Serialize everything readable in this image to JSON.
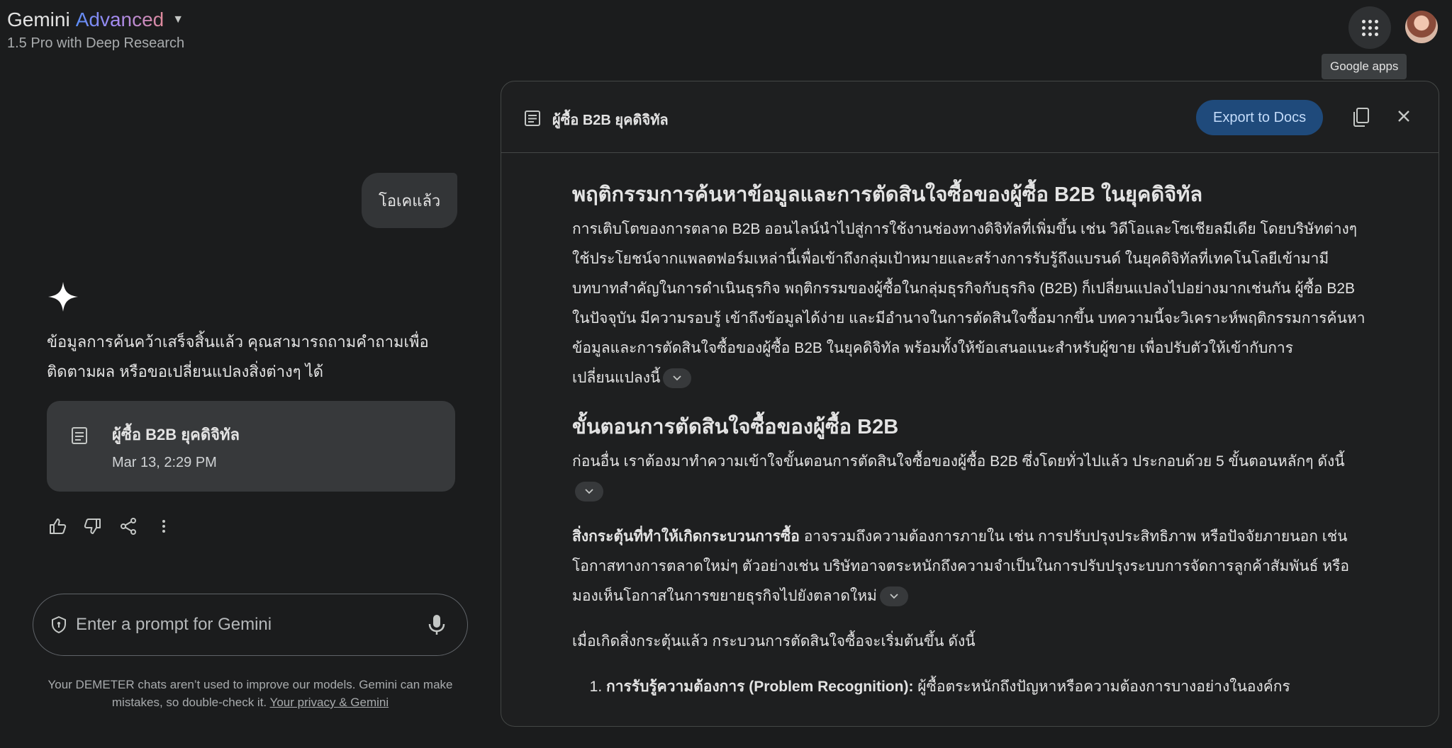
{
  "header": {
    "brand_name": "Gemini",
    "brand_tier": "Advanced",
    "model_subtitle": "1.5 Pro with Deep Research",
    "apps_tooltip": "Google apps",
    "icons": {
      "apps": "apps-grid-icon",
      "avatar": "user-avatar",
      "caret": "caret-down-icon"
    }
  },
  "chat": {
    "user_message": "โอเคแล้ว",
    "answer_text": "ข้อมูลการค้นคว้าเสร็จสิ้นแล้ว คุณสามารถถามคำถามเพื่อติดตามผล หรือขอเปลี่ยนแปลงสิ่งต่างๆ ได้",
    "doc_card": {
      "title": "ผู้ซื้อ B2B ยุคดิจิทัล",
      "date": "Mar 13, 2:29 PM"
    },
    "actions": [
      "thumb-up-icon",
      "thumb-down-icon",
      "share-icon",
      "more-vert-icon"
    ]
  },
  "prompt": {
    "placeholder": "Enter a prompt for Gemini",
    "disclaimer": "Your DEMETER chats aren’t used to improve our models. Gemini can make mistakes, so double-check it.",
    "privacy_link": "Your privacy & Gemini"
  },
  "panel": {
    "title": "ผู้ซื้อ B2B ยุคดิจิทัล",
    "export_label": "Export to Docs",
    "heading1": "พฤติกรรมการค้นหาข้อมูลและการตัดสินใจซื้อของผู้ซื้อ B2B ในยุคดิจิทัล",
    "para1": "การเติบโตของการตลาด B2B ออนไลน์นำไปสู่การใช้งานช่องทางดิจิทัลที่เพิ่มขึ้น เช่น วิดีโอและโซเชียลมีเดีย โดยบริษัทต่างๆ ใช้ประโยชน์จากแพลตฟอร์มเหล่านี้เพื่อเข้าถึงกลุ่มเป้าหมายและสร้างการรับรู้ถึงแบรนด์ ในยุคดิจิทัลที่เทคโนโลยีเข้ามามีบทบาทสำคัญในการดำเนินธุรกิจ พฤติกรรมของผู้ซื้อในกลุ่มธุรกิจกับธุรกิจ (B2B) ก็เปลี่ยนแปลงไปอย่างมากเช่นกัน ผู้ซื้อ B2B ในปัจจุบัน มีความรอบรู้ เข้าถึงข้อมูลได้ง่าย และมีอำนาจในการตัดสินใจซื้อมากขึ้น บทความนี้จะวิเคราะห์พฤติกรรมการค้นหาข้อมูลและการตัดสินใจซื้อของผู้ซื้อ B2B ในยุคดิจิทัล พร้อมทั้งให้ข้อเสนอแนะสำหรับผู้ขาย เพื่อปรับตัวให้เข้ากับการเปลี่ยนแปลงนี้",
    "heading2": "ขั้นตอนการตัดสินใจซื้อของผู้ซื้อ B2B",
    "para2": "ก่อนอื่น เราต้องมาทำความเข้าใจขั้นตอนการตัดสินใจซื้อของผู้ซื้อ B2B ซึ่งโดยทั่วไปแล้ว ประกอบด้วย 5 ขั้นตอนหลักๆ ดังนี้",
    "para3_bold": "สิ่งกระตุ้นที่ทำให้เกิดกระบวนการซื้อ",
    "para3": " อาจรวมถึงความต้องการภายใน เช่น การปรับปรุงประสิทธิภาพ หรือปัจจัยภายนอก เช่น โอกาสทางการตลาดใหม่ๆ ตัวอย่างเช่น บริษัทอาจตระหนักถึงความจำเป็นในการปรับปรุงระบบการจัดการลูกค้าสัมพันธ์ หรือมองเห็นโอกาสในการขยายธุรกิจไปยังตลาดใหม่",
    "para4": "เมื่อเกิดสิ่งกระตุ้นแล้ว กระบวนการตัดสินใจซื้อจะเริ่มต้นขึ้น ดังนี้",
    "list1_bold": "การรับรู้ความต้องการ (Problem Recognition):",
    "list1": " ผู้ซื้อตระหนักถึงปัญหาหรือความต้องการบางอย่างในองค์กร"
  }
}
